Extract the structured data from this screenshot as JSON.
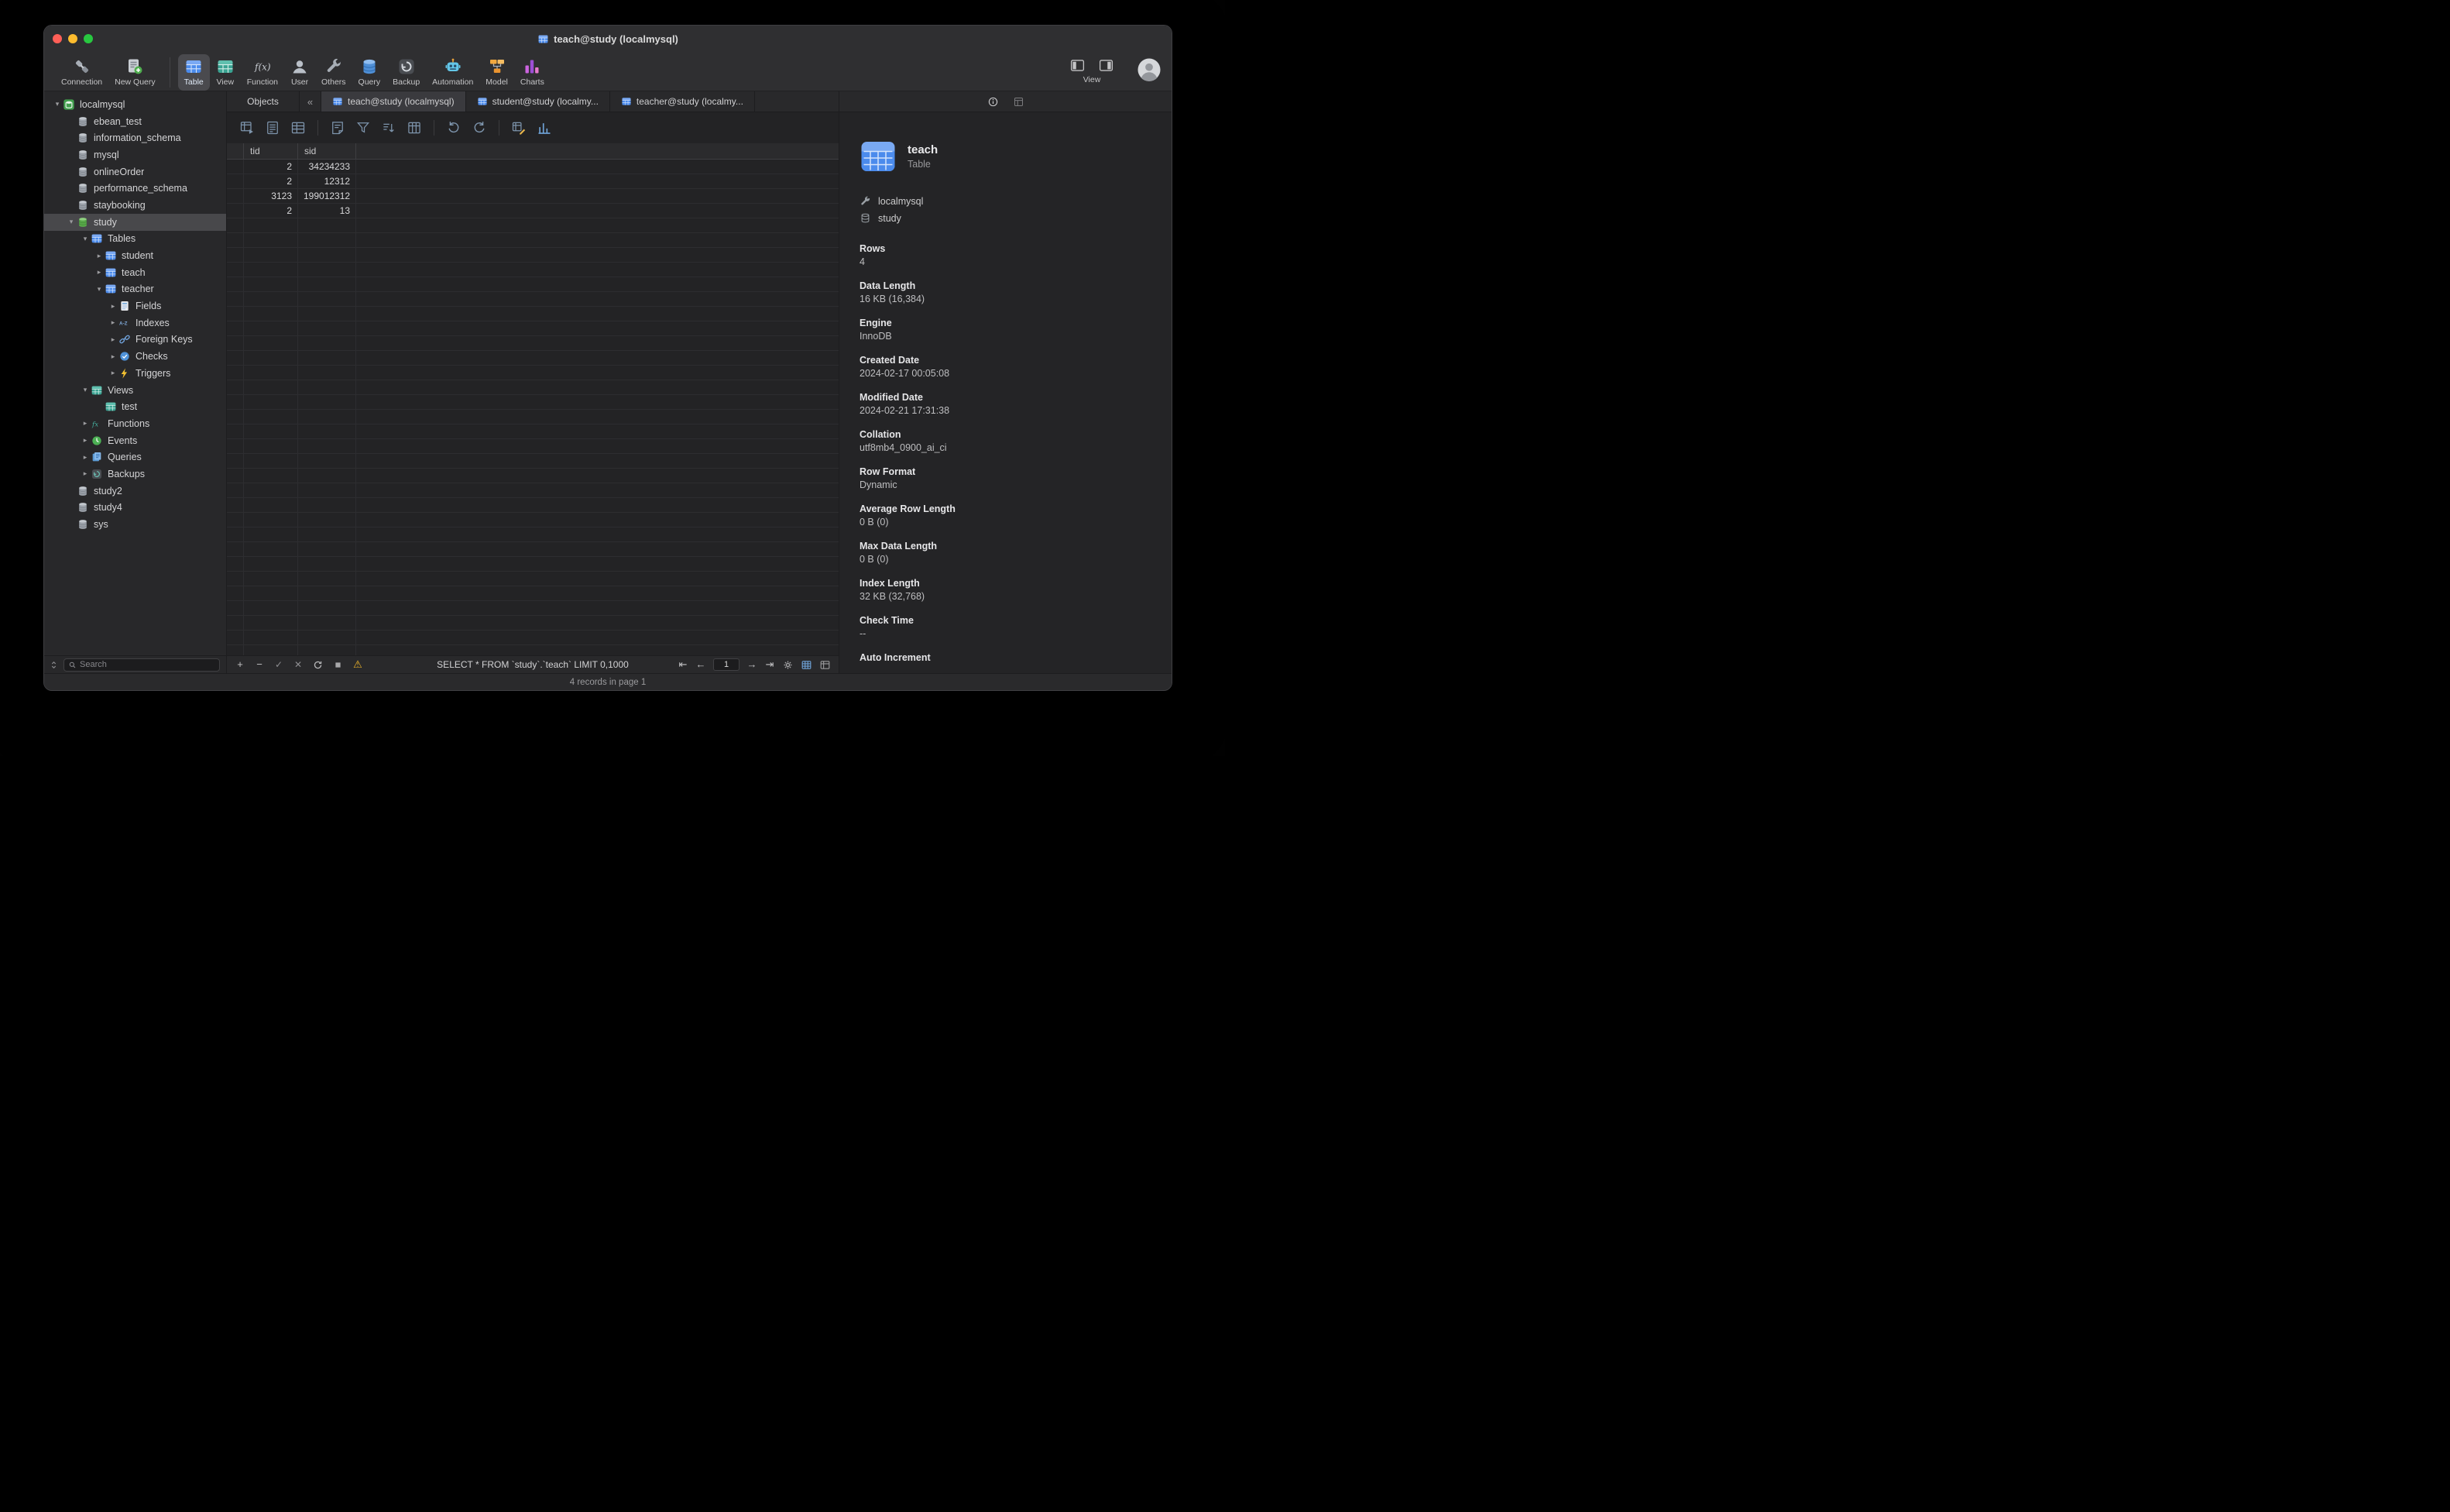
{
  "window": {
    "title": "teach@study (localmysql)"
  },
  "toolbar": {
    "items": [
      {
        "label": "Connection",
        "icon": "connection-icon"
      },
      {
        "label": "New Query",
        "icon": "new-query-icon"
      },
      {
        "label": "Table",
        "icon": "table-icon",
        "active": true
      },
      {
        "label": "View",
        "icon": "views-icon"
      },
      {
        "label": "Function",
        "icon": "function-icon"
      },
      {
        "label": "User",
        "icon": "user-icon"
      },
      {
        "label": "Others",
        "icon": "others-icon"
      },
      {
        "label": "Query",
        "icon": "query-icon"
      },
      {
        "label": "Backup",
        "icon": "backup-icon"
      },
      {
        "label": "Automation",
        "icon": "automation-icon"
      },
      {
        "label": "Model",
        "icon": "model-icon"
      },
      {
        "label": "Charts",
        "icon": "charts-icon"
      }
    ],
    "view_label": "View"
  },
  "sidebar": {
    "search_placeholder": "Search",
    "tree": [
      {
        "label": "localmysql",
        "level": 0,
        "icon": "mysql-connection-icon",
        "chevron": "expanded"
      },
      {
        "label": "ebean_test",
        "level": 1,
        "icon": "database-icon",
        "chevron": "none"
      },
      {
        "label": "information_schema",
        "level": 1,
        "icon": "database-icon",
        "chevron": "none"
      },
      {
        "label": "mysql",
        "level": 1,
        "icon": "database-icon",
        "chevron": "none"
      },
      {
        "label": "onlineOrder",
        "level": 1,
        "icon": "database-icon",
        "chevron": "none"
      },
      {
        "label": "performance_schema",
        "level": 1,
        "icon": "database-icon",
        "chevron": "none"
      },
      {
        "label": "staybooking",
        "level": 1,
        "icon": "database-icon",
        "chevron": "none"
      },
      {
        "label": "study",
        "level": 1,
        "icon": "database-open-icon",
        "chevron": "expanded",
        "selected": true
      },
      {
        "label": "Tables",
        "level": 2,
        "icon": "tables-icon",
        "chevron": "expanded"
      },
      {
        "label": "student",
        "level": 3,
        "icon": "table-icon",
        "chevron": "collapsed"
      },
      {
        "label": "teach",
        "level": 3,
        "icon": "table-icon",
        "chevron": "collapsed"
      },
      {
        "label": "teacher",
        "level": 3,
        "icon": "table-icon",
        "chevron": "expanded"
      },
      {
        "label": "Fields",
        "level": 4,
        "icon": "fields-icon",
        "chevron": "collapsed"
      },
      {
        "label": "Indexes",
        "level": 4,
        "icon": "indexes-icon",
        "chevron": "collapsed"
      },
      {
        "label": "Foreign Keys",
        "level": 4,
        "icon": "foreign-keys-icon",
        "chevron": "collapsed"
      },
      {
        "label": "Checks",
        "level": 4,
        "icon": "checks-icon",
        "chevron": "collapsed"
      },
      {
        "label": "Triggers",
        "level": 4,
        "icon": "triggers-icon",
        "chevron": "collapsed"
      },
      {
        "label": "Views",
        "level": 2,
        "icon": "views-icon",
        "chevron": "expanded"
      },
      {
        "label": "test",
        "level": 3,
        "icon": "view-icon",
        "chevron": "none"
      },
      {
        "label": "Functions",
        "level": 2,
        "icon": "functions-icon",
        "chevron": "collapsed"
      },
      {
        "label": "Events",
        "level": 2,
        "icon": "events-icon",
        "chevron": "collapsed"
      },
      {
        "label": "Queries",
        "level": 2,
        "icon": "queries-icon",
        "chevron": "collapsed"
      },
      {
        "label": "Backups",
        "level": 2,
        "icon": "backups-icon",
        "chevron": "collapsed"
      },
      {
        "label": "study2",
        "level": 1,
        "icon": "database-icon",
        "chevron": "none"
      },
      {
        "label": "study4",
        "level": 1,
        "icon": "database-icon",
        "chevron": "none"
      },
      {
        "label": "sys",
        "level": 1,
        "icon": "database-icon",
        "chevron": "none"
      }
    ]
  },
  "tabs": {
    "objects_label": "Objects",
    "collapse_glyph": "«",
    "items": [
      {
        "label": "teach@study (localmysql)",
        "icon": "table-icon",
        "active": true
      },
      {
        "label": "student@study (localmy...",
        "icon": "table-icon"
      },
      {
        "label": "teacher@study (localmy...",
        "icon": "table-icon"
      }
    ]
  },
  "grid_toolbar": {
    "groups": [
      [
        "begin-transaction-icon",
        "text-view-icon",
        "form-view-icon"
      ],
      [
        "memo-icon",
        "filter-icon",
        "sort-icon",
        "columns-icon"
      ],
      [
        "import-wizard-icon",
        "export-wizard-icon"
      ],
      [
        "edit-table-icon",
        "chart-icon"
      ]
    ]
  },
  "grid": {
    "columns": [
      "tid",
      "sid"
    ],
    "rows": [
      [
        "2",
        "34234233"
      ],
      [
        "2",
        "12312"
      ],
      [
        "3123",
        "199012312"
      ],
      [
        "2",
        "13"
      ]
    ]
  },
  "bottom_toolbar": {
    "left_icons": [
      "add-record-icon",
      "delete-record-icon",
      "apply-changes-icon",
      "discard-changes-icon",
      "refresh-icon",
      "stop-icon",
      "warning-icon"
    ],
    "sql": "SELECT * FROM `study`.`teach` LIMIT 0,1000",
    "nav_icons_before": [
      "first-page-icon",
      "prev-page-icon"
    ],
    "page_value": "1",
    "nav_icons_after": [
      "next-page-icon",
      "last-page-icon",
      "settings-icon",
      "grid-view-toggle-icon",
      "form-view-toggle-icon"
    ]
  },
  "statusbar": {
    "text": "4 records in page 1"
  },
  "info_panel": {
    "title": "teach",
    "subtitle": "Table",
    "connection": "localmysql",
    "database": "study",
    "fields": [
      {
        "label": "Rows",
        "value": "4"
      },
      {
        "label": "Data Length",
        "value": "16 KB (16,384)"
      },
      {
        "label": "Engine",
        "value": "InnoDB"
      },
      {
        "label": "Created Date",
        "value": "2024-02-17 00:05:08"
      },
      {
        "label": "Modified Date",
        "value": "2024-02-21 17:31:38"
      },
      {
        "label": "Collation",
        "value": "utf8mb4_0900_ai_ci"
      },
      {
        "label": "Row Format",
        "value": "Dynamic"
      },
      {
        "label": "Average Row Length",
        "value": "0 B (0)"
      },
      {
        "label": "Max Data Length",
        "value": "0 B (0)"
      },
      {
        "label": "Index Length",
        "value": "32 KB (32,768)"
      },
      {
        "label": "Check Time",
        "value": "--"
      },
      {
        "label": "Auto Increment",
        "value": ""
      }
    ]
  }
}
